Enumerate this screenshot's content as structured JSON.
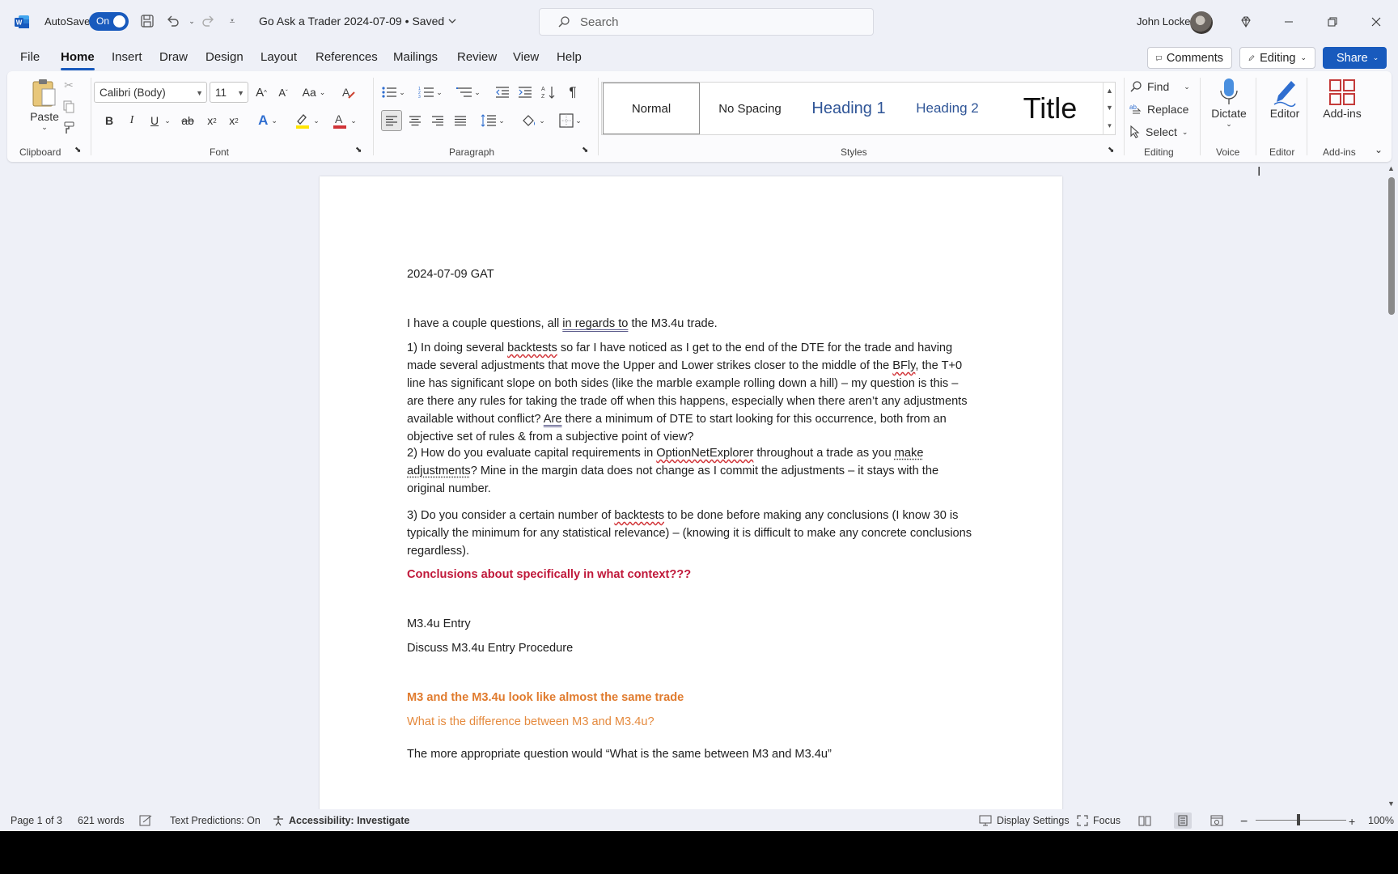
{
  "titlebar": {
    "autosave_label": "AutoSave",
    "autosave_state": "On",
    "doc_title": "Go Ask a Trader 2024-07-09",
    "save_state": "• Saved",
    "search_placeholder": "Search",
    "user_name": "John Locke"
  },
  "tabs": [
    "File",
    "Home",
    "Insert",
    "Draw",
    "Design",
    "Layout",
    "References",
    "Mailings",
    "Review",
    "View",
    "Help"
  ],
  "active_tab": "Home",
  "actions": {
    "comments": "Comments",
    "editing": "Editing",
    "share": "Share"
  },
  "ribbon": {
    "clipboard": {
      "paste": "Paste",
      "label": "Clipboard"
    },
    "font": {
      "family": "Calibri (Body)",
      "size": "11",
      "change_case": "Aa",
      "label": "Font"
    },
    "paragraph": {
      "label": "Paragraph"
    },
    "styles": {
      "label": "Styles",
      "items": [
        "Normal",
        "No Spacing",
        "Heading 1",
        "Heading 2",
        "Title"
      ]
    },
    "editing": {
      "find": "Find",
      "replace": "Replace",
      "select": "Select",
      "label": "Editing"
    },
    "voice": {
      "dictate": "Dictate",
      "label": "Voice"
    },
    "editor": {
      "editor": "Editor",
      "label": "Editor"
    },
    "addins": {
      "addins": "Add-ins",
      "label": "Add-ins"
    }
  },
  "document": {
    "date_line": "2024-07-09 GAT",
    "intro_a": "I have a couple questions, all ",
    "intro_link": "in regards to",
    "intro_b": " the M3.4u trade.",
    "q1": [
      "1) In doing several ",
      "backtests",
      " so far I have noticed as I get to the end of the DTE for the trade and having made several adjustments that move the Upper and Lower strikes closer to the middle of the ",
      "BFly",
      ", the T+0 line has significant slope on both sides (like the marble example rolling down a hill) – my question is this – are there any rules for taking the trade off when this happens, especially when there aren’t any adjustments available without conflict? ",
      "Are",
      " there a minimum of DTE to start looking for this occurrence, both from an objective set of rules & from a subjective point of view?"
    ],
    "q2": [
      "2) How do you evaluate capital requirements in ",
      "OptionNetExplorer",
      " throughout a trade as you ",
      "make adjustments",
      "? Mine in the margin data does not change as I commit the adjustments – it stays with the original number."
    ],
    "q3": [
      "3) Do you consider a certain number of ",
      "backtests",
      " to be done before making any conclusions (I know 30 is typically the minimum for any statistical relevance) – (knowing it is difficult to make any concrete conclusions regardless)."
    ],
    "red_note": "Conclusions about specifically in what context???",
    "entry_heading": "M3.4u Entry",
    "entry_sub": "Discuss M3.4u Entry Procedure",
    "orange1": "M3 and the M3.4u look like almost the same trade",
    "orange2": "What is the difference between M3 and M3.4u?",
    "last_line": "The more appropriate question would “What is the same between M3 and M3.4u”"
  },
  "status": {
    "page": "Page 1 of 3",
    "words": "621 words",
    "predictions": "Text Predictions: On",
    "accessibility": "Accessibility: Investigate",
    "display": "Display Settings",
    "focus": "Focus",
    "zoom": "100%"
  },
  "colors": {
    "accent": "#185abd",
    "red_text": "#c0183a",
    "orange_text": "#e07b2e"
  }
}
